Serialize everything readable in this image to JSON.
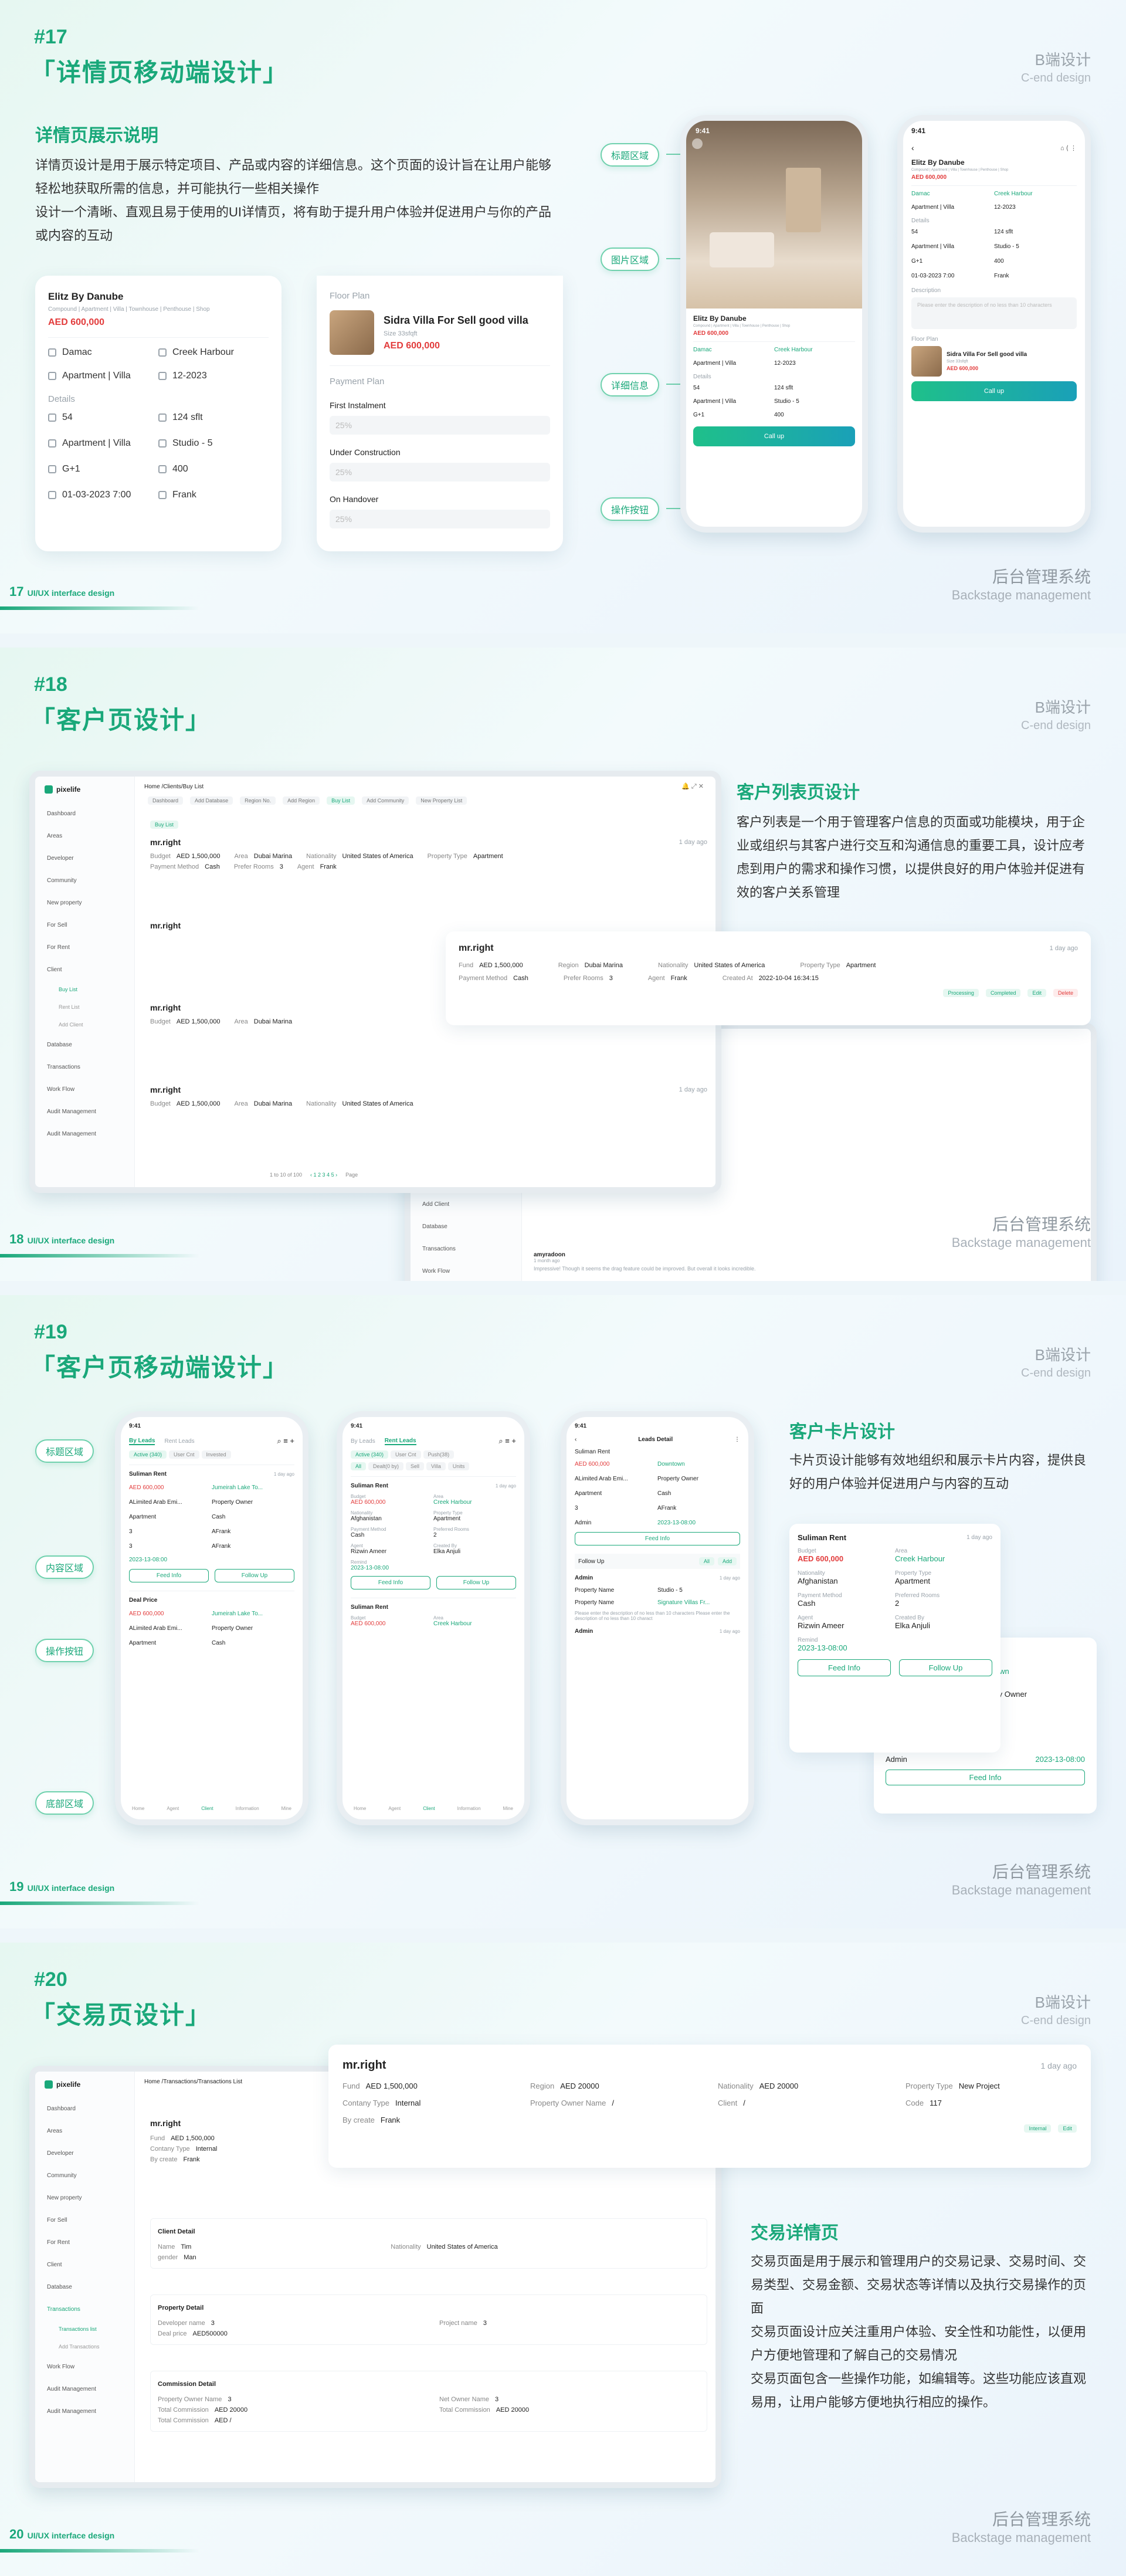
{
  "brand": {
    "right_cn": "B端设计",
    "right_en": "C-end design",
    "back_cn": "后台管理系统",
    "back_en": "Backstage management",
    "foot_suffix": "UI/UX interface design"
  },
  "s17": {
    "num": "#17",
    "title": "详情页移动端设计",
    "foot_num": "17",
    "h2": "详情页展示说明",
    "p1": "详情页设计是用于展示特定项目、产品或内容的详细信息。这个页面的设计旨在让用户能够轻松地获取所需的信息，并可能执行一些相关操作",
    "p2": "设计一个清晰、直观且易于使用的UI详情页，将有助于提升用户体验并促进用户与你的产品或内容的互动",
    "card1": {
      "name": "Elitz By Danube",
      "sub": "Compound | Apartment | Villa | Townhouse | Penthouse | Shop",
      "price": "AED 600,000",
      "loc1": "Damac",
      "loc2": "Creek Harbour",
      "type": "Apartment | Villa",
      "date": "12-2023",
      "details": "Details",
      "d1": "54",
      "d2": "124 sflt",
      "d3": "Apartment | Villa",
      "d4": "Studio - 5",
      "d5": "G+1",
      "d6": "400",
      "d7": "01-03-2023 7:00",
      "d8": "Frank"
    },
    "card2": {
      "floor": "Floor Plan",
      "name": "Sidra Villa For Sell good villa",
      "size": "Size 33sfqft",
      "price": "AED 600,000",
      "plan": "Payment Plan",
      "l1": "First Instalment",
      "v1": "25%",
      "l2": "Under Construction",
      "v2": "25%",
      "l3": "On Handover",
      "v3": "25%"
    },
    "pills": [
      "标题区域",
      "图片区域",
      "详细信息",
      "操作按钮"
    ],
    "phone1": {
      "time": "9:41",
      "name": "Elitz By Danube",
      "sub": "Compound | Apartment | Villa | Townhouse | Penthouse | Shop",
      "price": "AED 600,000",
      "loc1": "Damac",
      "loc2": "Creek Harbour",
      "type": "Apartment | Villa",
      "date": "12-2023",
      "details": "Details",
      "d1": "54",
      "d2": "124 sflt",
      "d3": "Apartment | Villa",
      "d4": "Studio - 5",
      "d5": "G+1",
      "d6": "400",
      "btn": "Call up"
    },
    "phone2": {
      "time": "9:41",
      "name": "Elitz By Danube",
      "sub": "Compound | Apartment | Villa | Townhouse | Penthouse | Shop",
      "price": "AED 600,000",
      "loc1": "Damac",
      "loc2": "Creek Harbour",
      "type": "Apartment | Villa",
      "date": "12-2023",
      "details": "Details",
      "d1": "54",
      "d2": "124 sflt",
      "d3": "Apartment | Villa",
      "d4": "Studio - 5",
      "d5": "G+1",
      "d6": "400",
      "d7": "01-03-2023 7:00",
      "d8": "Frank",
      "desc_l": "Description",
      "desc_p": "Please enter the description of no less than 10 characters",
      "floor": "Floor Plan",
      "fname": "Sidra Villa For Sell good villa",
      "fsize": "Size 33sfqft",
      "fprice": "AED 600,000",
      "btn": "Call up"
    }
  },
  "s18": {
    "num": "#18",
    "title": "客户页设计",
    "foot_num": "18",
    "h2": "客户列表页设计",
    "p": "客户列表是一个用于管理客户信息的页面或功能模块，用于企业或组织与其客户进行交互和沟通信息的重要工具，设计应考虑到用户的需求和操作习惯，以提供良好的用户体验并促进有效的客户关系管理",
    "logo": "pixelife",
    "crumb": "Home /Clients/Buy List",
    "side": [
      "Dashboard",
      "Areas",
      "Developer",
      "Community",
      "New property",
      "For Sell",
      "For Rent",
      "Client",
      "Buy List",
      "Rent List",
      "Add Client",
      "Database",
      "Transactions",
      "Work Flow",
      "Audit Management",
      "Audit Management"
    ],
    "filters": [
      "Dashboard",
      "Add Database",
      "Region No.",
      "Add Region",
      "Buy List",
      "Add Community",
      "New Property List"
    ],
    "rowname": "mr.right",
    "ago": "1 day ago",
    "budget_l": "Budget",
    "budget": "AED 1,500,000",
    "area_l": "Area",
    "area": "Dubai Marina",
    "nat_l": "Nationality",
    "nat": "United States of America",
    "ptype_l": "Property Type",
    "ptype": "Apartment",
    "pm_l": "Payment Method",
    "pm": "Cash",
    "rooms_l": "Prefer Rooms",
    "rooms": "3",
    "agent_l": "Agent",
    "agent": "Frank",
    "pop": {
      "name": "mr.right",
      "ago": "1 day ago",
      "fund_l": "Fund",
      "fund": "AED 1,500,000",
      "region_l": "Region",
      "region": "Dubai Marina",
      "nat_l": "Nationality",
      "nat": "United States of America",
      "pt_l": "Property Type",
      "pt": "Apartment",
      "pm_l": "Payment Method",
      "pm": "Cash",
      "rooms_l": "Prefer Rooms",
      "rooms": "3",
      "agent_l": "Agent",
      "agent": "Frank",
      "created_l": "Created At",
      "created": "2022-10-04 16:34:15",
      "b1": "Processing",
      "b2": "Completed",
      "b3": "Edit",
      "b4": "Delete"
    },
    "back": {
      "name": "amyradoon",
      "ago": "1 month ago",
      "txt": "Impressive! Though it seems the drag feature could be improved. But overall it looks incredible.",
      "side": [
        "Add Client",
        "Database",
        "Transactions",
        "Work Flow"
      ]
    },
    "pager": "1 to 10 of 100",
    "page": "Page"
  },
  "s19": {
    "num": "#19",
    "title": "客户页移动端设计",
    "foot_num": "19",
    "h2": "客户卡片设计",
    "p": "卡片页设计能够有效地组织和展示卡片内容，提供良好的用户体验并促进用户与内容的互动",
    "pills": [
      "标题区域",
      "内容区域",
      "操作按钮",
      "底部区域"
    ],
    "p1": {
      "time": "9:41",
      "tab1": "By Leads",
      "tab2": "Rent Leads",
      "f1": "Active (340)",
      "f2": "User Cnt",
      "f3": "Invested",
      "name": "Suliman Rent",
      "ago": "1 day ago",
      "price": "AED 600,000",
      "loc": "Jumeirah Lake To...",
      "v1": "ALimited Arab Emi...",
      "v2": "Property Owner",
      "v3": "Apartment",
      "v4": "Cash",
      "v5": "3",
      "v6": "AFrank",
      "v7": "3",
      "v8": "AFrank",
      "date": "2023-13-08:00",
      "b1": "Feed Info",
      "b2": "Follow Up",
      "name2": "Deal Price",
      "nav": [
        "Home",
        "Agent",
        "Client",
        "Information",
        "Mine"
      ]
    },
    "p2": {
      "time": "9:41",
      "tab1": "By Leads",
      "tab2": "Rent Leads",
      "f1": "Active (340)",
      "f2": "User Cnt",
      "f3": "Push(38)",
      "chips": [
        "All",
        "Dealt(0 by)",
        "Sell",
        "Villa",
        "Units"
      ],
      "name": "Suliman Rent",
      "ago": "1 day ago",
      "budget_l": "Budget",
      "budget": "AED 600,000",
      "area_l": "Area",
      "area": "Creek Harbour",
      "nat_l": "Nationality",
      "nat": "Afghanistan",
      "pt_l": "Property Type",
      "pt": "Apartment",
      "pm_l": "Payment Method",
      "pm": "Cash",
      "pr_l": "Preferred Rooms",
      "pr": "2",
      "ag_l": "Agent",
      "ag": "Rizwin Ameer",
      "cr_l": "Created By",
      "cr": "Elka Anjuli",
      "rem_l": "Remind",
      "rem": "2023-13-08:00",
      "b1": "Feed Info",
      "b2": "Follow Up",
      "name2": "Suliman Rent"
    },
    "p3": {
      "time": "9:41",
      "title": "Leads Detail",
      "name": "Suliman Rent",
      "price": "AED 600,000",
      "loc": "Downtown",
      "v1": "ALimited Arab Emi...",
      "v2": "Property Owner",
      "v3": "Apartment",
      "v4": "Cash",
      "v5": "3",
      "v6": "AFrank",
      "v7": "Admin",
      "date": "2023-13-08:00",
      "btn": "Feed Info",
      "fu": "Follow Up",
      "fu_all": "All",
      "fu_add": "Add",
      "admin": "Admin",
      "ago": "1 day ago",
      "pn": "Property Name",
      "st": "Studio - 5",
      "pn2": "Property Name",
      "sv": "Signature Villas Fr...",
      "desc": "Please enter the description of no less than 10 characters Please enter the description of no less than 10 charact"
    },
    "card": {
      "name": "Suliman Rent",
      "ago": "1 day ago",
      "budget_l": "Budget",
      "budget": "AED 600,000",
      "area_l": "Area",
      "area": "Creek Harbour",
      "nat_l": "Nationality",
      "nat": "Afghanistan",
      "pt_l": "Property Type",
      "pt": "Apartment",
      "pm_l": "Payment Method",
      "pm": "Cash",
      "pr_l": "Preferred Rooms",
      "pr": "2",
      "ag_l": "Agent",
      "ag": "Rizwin Ameer",
      "cr_l": "Created By",
      "cr": "Elka Anjuli",
      "rem_l": "Remind",
      "rem": "2023-13-08:00",
      "b1": "Feed Info",
      "b2": "Follow Up"
    },
    "back": {
      "v1": "Downtown",
      "v2": "Property Owner",
      "v3": "Cash",
      "v4": "AFrank",
      "admin": "Admin",
      "date": "2023-13-08:00",
      "btn": "Feed Info"
    }
  },
  "s20": {
    "num": "#20",
    "title": "交易页设计",
    "foot_num": "20",
    "h2": "交易详情页",
    "p1": "交易页面是用于展示和管理用户的交易记录、交易时间、交易类型、交易金额、交易状态等详情以及执行交易操作的页面",
    "p2": "交易页面设计应关注重用户体验、安全性和功能性，以便用户方便地管理和了解自己的交易情况",
    "p3": "交易页面包含一些操作功能，如编辑等。这些功能应该直观易用，让用户能够方便地执行相应的操作。",
    "logo": "pixelife",
    "crumb": "Home /Transactions/Transactions List",
    "side": [
      "Dashboard",
      "Areas",
      "Developer",
      "Community",
      "New property",
      "For Sell",
      "For Rent",
      "Client",
      "Database",
      "Transactions",
      "Transactions list",
      "Add Transactions",
      "Work Flow",
      "Audit Management",
      "Audit Management"
    ],
    "pop": {
      "name": "mr.right",
      "ago": "1 day ago",
      "fund_l": "Fund",
      "fund": "AED 1,500,000",
      "region_l": "Region",
      "region": "AED 20000",
      "nat_l": "Nationality",
      "nat": "AED 20000",
      "pt_l": "Property Type",
      "pt": "New Project",
      "ct_l": "Contany Type",
      "ct": "Internal",
      "pon_l": "Property Owner Name",
      "pon": "/",
      "client_l": "Client",
      "client": "/",
      "code_l": "Code",
      "code": "117",
      "by_l": "By create",
      "by": "Frank",
      "b1": "Internal",
      "b2": "Edit"
    },
    "detail": {
      "name": "mr.right",
      "fund_l": "Fund",
      "fund": "AED 1,500,000",
      "ct_l": "Contany Type",
      "ct": "Internal",
      "by_l": "By create",
      "by": "Frank",
      "client": "Client Detail",
      "n_l": "Name",
      "n": "Tim",
      "g_l": "gender",
      "g": "Man",
      "nat_l": "Nationality",
      "nat": "United States of America",
      "prop": "Property Detail",
      "dev_l": "Developer name",
      "dev": "3",
      "pn_l": "Project name",
      "pn": "3",
      "price_l": "Deal price",
      "price": "AED500000",
      "comm": "Commission Detail",
      "pon_l": "Property Owner Name",
      "pon": "3",
      "tc_l": "Total Commission",
      "tc": "AED 20000",
      "tcc_l": "Total Commission",
      "tcc": "AED /",
      "nso_l": "Net Owner Name",
      "nso": "3",
      "tc2_l": "Total Commission",
      "tc2": "AED 20000"
    }
  }
}
